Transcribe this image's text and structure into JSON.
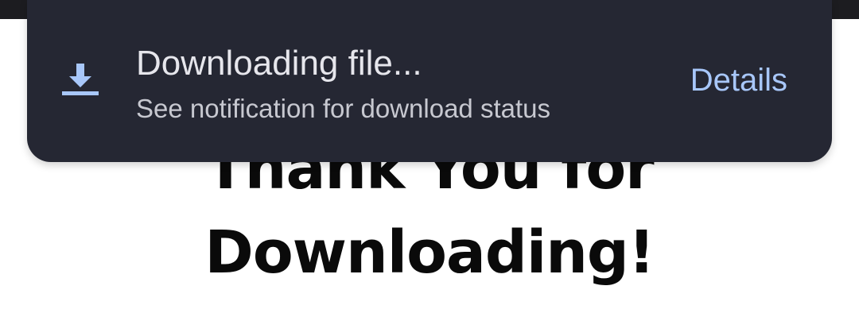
{
  "page": {
    "headline_line1": "Thank You for",
    "headline_line2": "Downloading!"
  },
  "snackbar": {
    "icon": "download-icon",
    "title": "Downloading file...",
    "subtitle": "See notification for download status",
    "action_label": "Details",
    "colors": {
      "background": "#252733",
      "title": "#e6e6ec",
      "subtitle": "#c7c8d0",
      "action": "#a8c7fa",
      "icon": "#a8c7fa"
    }
  }
}
